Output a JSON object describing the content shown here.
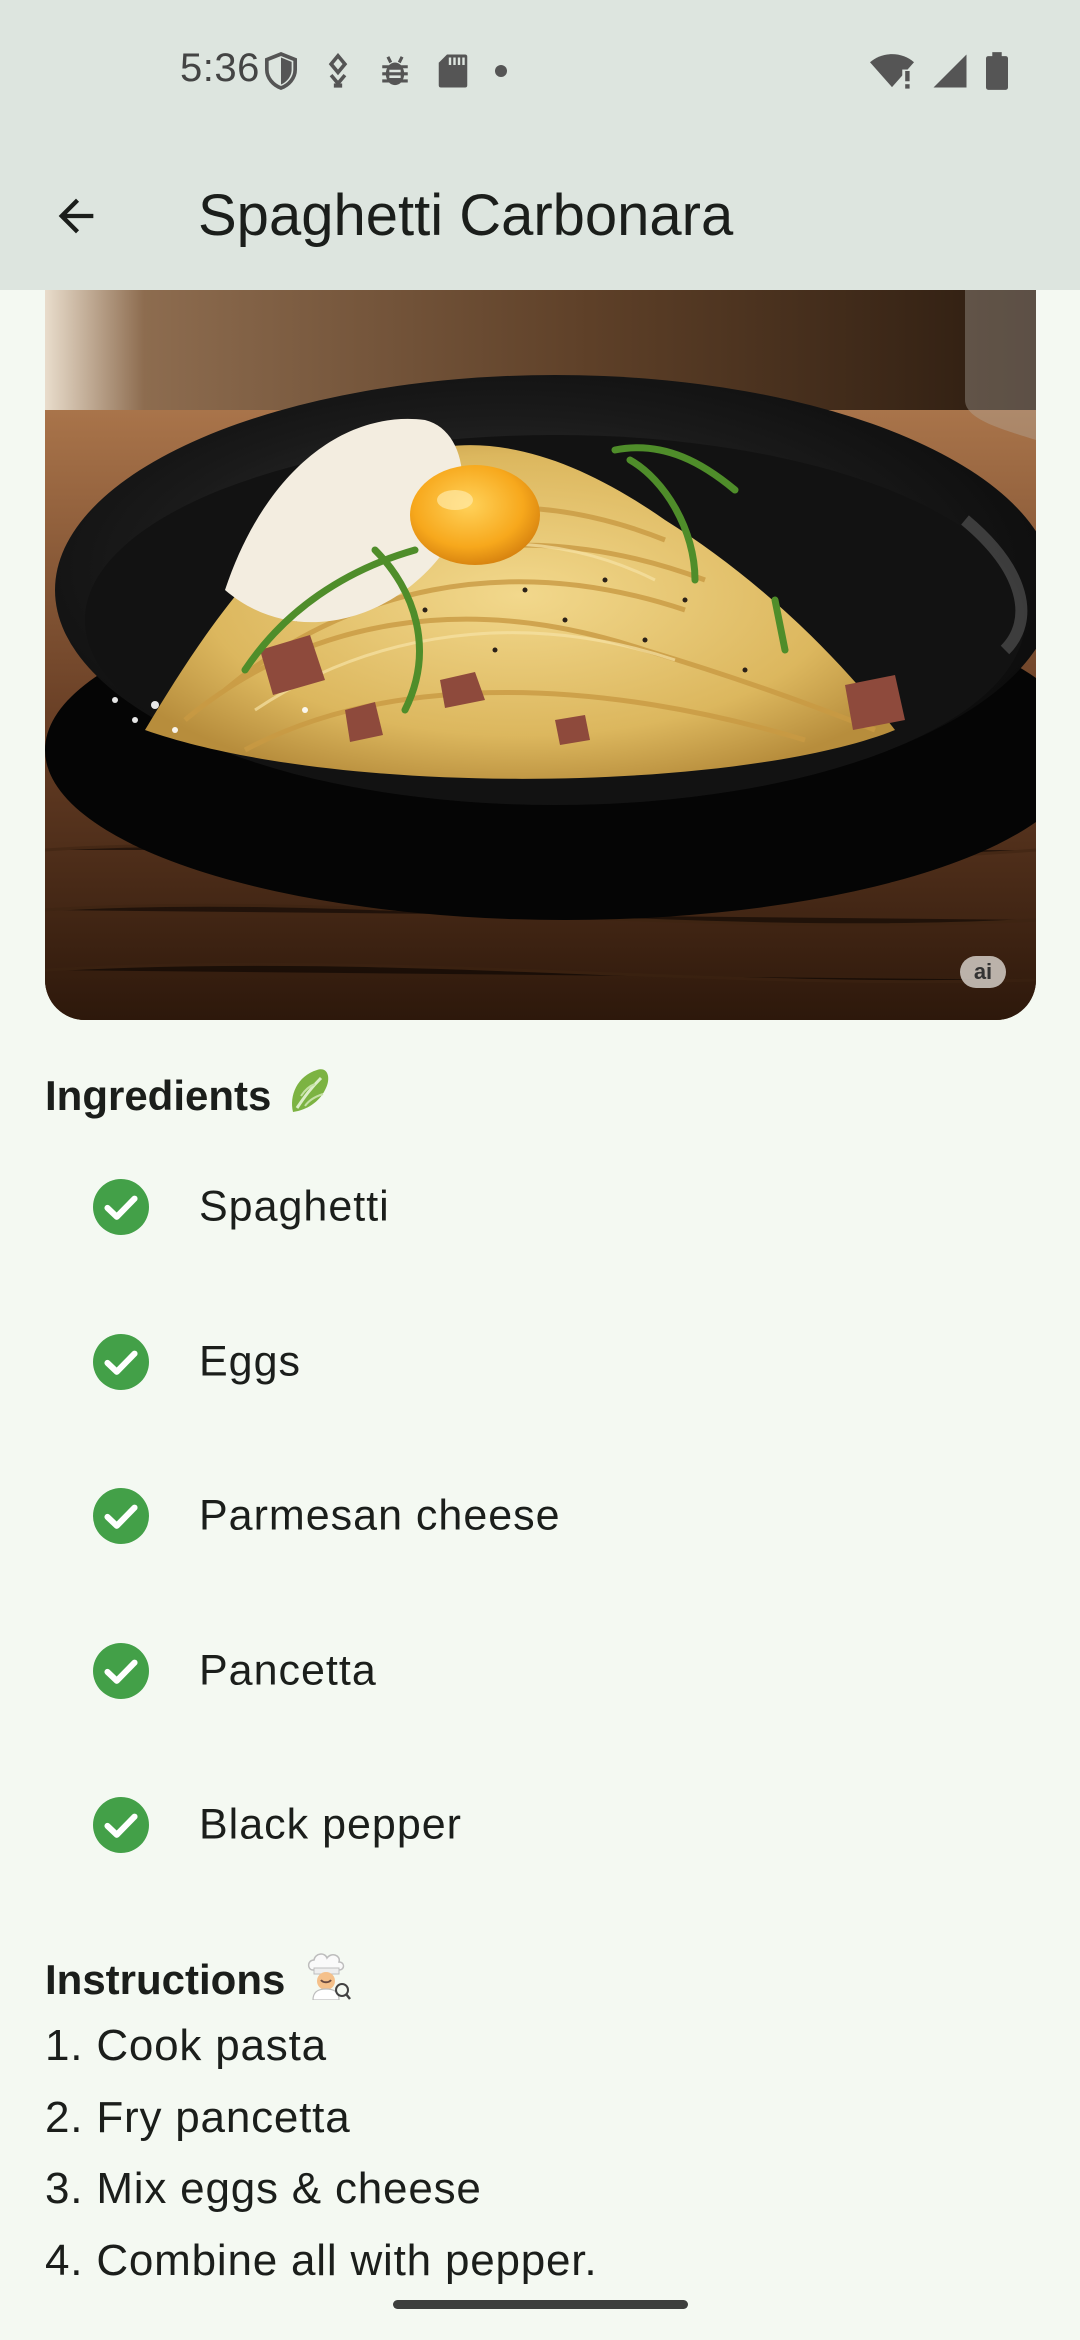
{
  "status_bar": {
    "time": "5:36",
    "left_icons": [
      "shield-icon",
      "usb-debug-icon",
      "bug-icon",
      "sd-card-icon",
      "notification-dot-icon"
    ],
    "right_icons": [
      "wifi-alert-icon",
      "signal-icon",
      "battery-icon"
    ]
  },
  "app_bar": {
    "title": "Spaghetti Carbonara",
    "back_icon": "arrow-back-icon"
  },
  "hero": {
    "image_alt": "Spaghetti carbonara with egg yolk and parmesan in a black bowl",
    "badge": "ai"
  },
  "ingredients": {
    "title": "Ingredients",
    "emoji": "🥬",
    "check_color": "#43a048",
    "items": [
      {
        "label": "Spaghetti"
      },
      {
        "label": "Eggs"
      },
      {
        "label": "Parmesan cheese"
      },
      {
        "label": "Pancetta"
      },
      {
        "label": "Black pepper"
      }
    ]
  },
  "instructions": {
    "title": "Instructions",
    "emoji": "👨‍🍳",
    "steps": [
      "1. Cook pasta",
      "2. Fry pancetta",
      "3. Mix eggs & cheese",
      "4. Combine all with pepper."
    ]
  }
}
